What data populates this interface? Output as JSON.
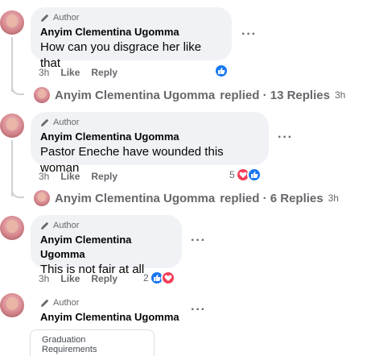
{
  "colors": {
    "like_blue": "#1877f2",
    "love_red": "#f33e58",
    "bubble_bg": "#f0f2f5",
    "muted": "#65676b"
  },
  "comments": [
    {
      "badge": "Author",
      "name": "Anyim Clementina Ugomma",
      "text": "How can you disgrace her like that",
      "time": "3h",
      "like_label": "Like",
      "reply_label": "Reply",
      "reaction_count": "",
      "replies": {
        "author": "Anyim Clementina Ugomma",
        "label": "replied · 13 Replies",
        "time": "3h"
      }
    },
    {
      "badge": "Author",
      "name": "Anyim Clementina Ugomma",
      "text": "Pastor Eneche have wounded this woman",
      "time": "3h",
      "like_label": "Like",
      "reply_label": "Reply",
      "reaction_count": "5",
      "replies": {
        "author": "Anyim Clementina Ugomma",
        "label": "replied · 6 Replies",
        "time": "3h"
      }
    },
    {
      "badge": "Author",
      "name": "Anyim Clementina Ugomma",
      "text": "This is not fair at all",
      "time": "3h",
      "like_label": "Like",
      "reply_label": "Reply",
      "reaction_count": "2"
    },
    {
      "badge": "Author",
      "name": "Anyim Clementina Ugomma",
      "attachment": {
        "line1": "Graduation",
        "line2": "Requirements"
      }
    }
  ],
  "icons": {
    "author": "pencil-icon",
    "more": "more-options-icon",
    "like": "like-reaction-icon",
    "love": "love-reaction-icon"
  }
}
